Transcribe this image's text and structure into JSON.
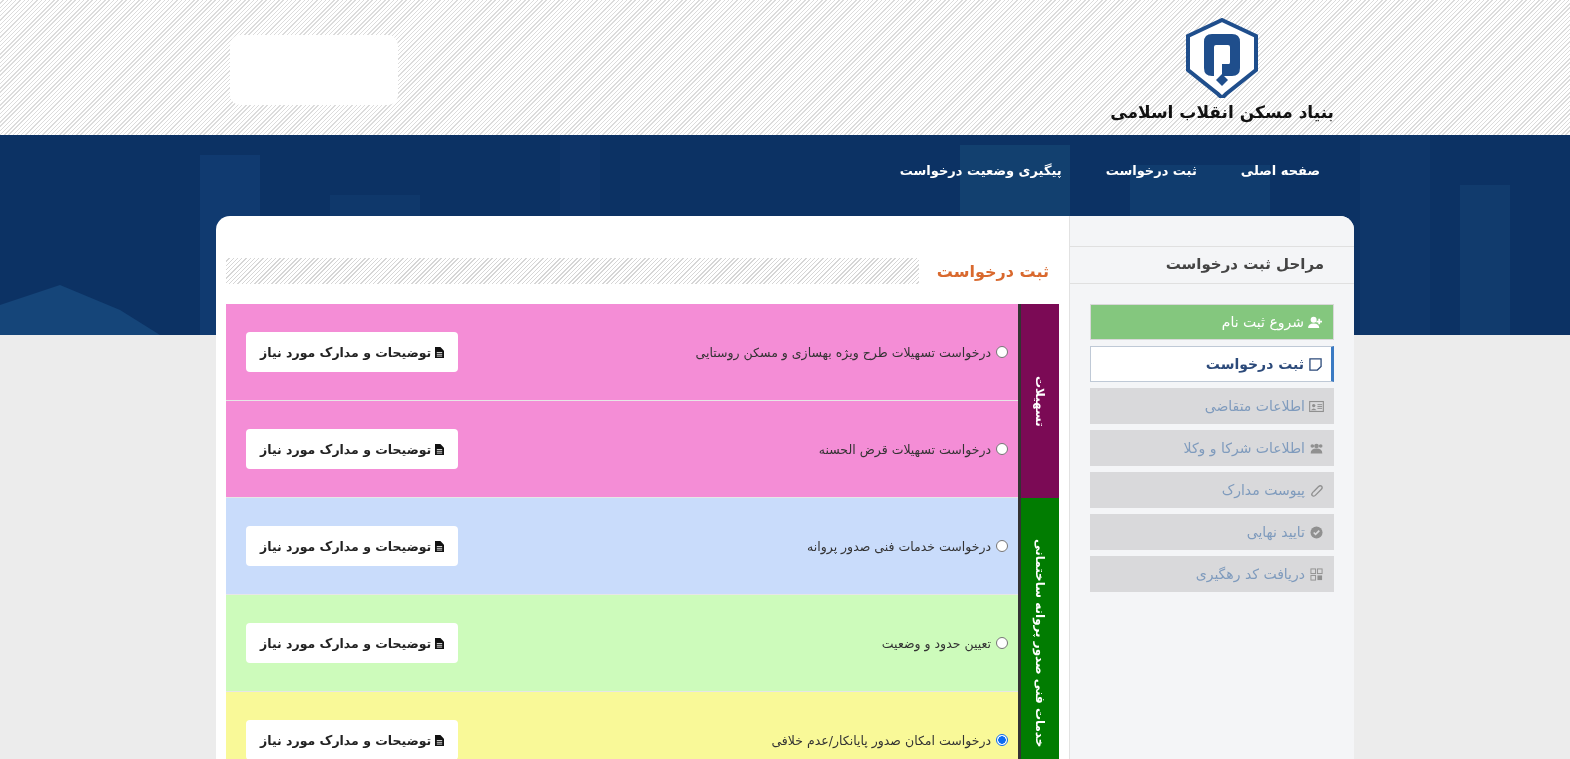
{
  "header": {
    "org_name": "بنیاد مسکن انقلاب اسلامی"
  },
  "nav": [
    {
      "label": "صفحه اصلی"
    },
    {
      "label": "ثبت درخواست"
    },
    {
      "label": "پیگیری وضعیت درخواست"
    }
  ],
  "sidebar": {
    "title": "مراحل ثبت درخواست",
    "steps": [
      {
        "label": "شروع ثبت نام",
        "kind": "done"
      },
      {
        "label": "ثبت درخواست",
        "kind": "current"
      },
      {
        "label": "اطلاعات متقاضی",
        "kind": "pending"
      },
      {
        "label": "اطلاعات شرکا و وکلا",
        "kind": "pending"
      },
      {
        "label": "پیوست مدارک",
        "kind": "pending"
      },
      {
        "label": "تایید نهایی",
        "kind": "pending"
      },
      {
        "label": "دریافت کد رهگیری",
        "kind": "pending"
      }
    ]
  },
  "main": {
    "title": "ثبت درخواست",
    "groups": [
      {
        "label": "تسهیلات",
        "color": "#7b0a55",
        "items": [
          {
            "text": "درخواست تسهیلات طرح ویژه بهسازی و مسکن روستایی",
            "selected": false,
            "color": "#f48dd6",
            "button": "توضیحات و مدارک مورد نیاز"
          },
          {
            "text": "درخواست تسهیلات قرض الحسنه",
            "selected": false,
            "color": "#f48dd6",
            "button": "توضیحات و مدارک مورد نیاز"
          }
        ]
      },
      {
        "label": "خدمات فنی صدور پروانه ساختمانی",
        "color": "#017c01",
        "items": [
          {
            "text": "درخواست خدمات فنی صدور پروانه",
            "selected": false,
            "color": "#c9dcfb",
            "button": "توضیحات و مدارک مورد نیاز"
          },
          {
            "text": "تعیین حدود و وضعیت",
            "selected": false,
            "color": "#cdfbbb",
            "button": "توضیحات و مدارک مورد نیاز"
          },
          {
            "text": "درخواست امکان صدور پایانکار/عدم خلافی",
            "selected": true,
            "color": "#f9f998",
            "button": "توضیحات و مدارک مورد نیاز"
          }
        ]
      }
    ]
  }
}
